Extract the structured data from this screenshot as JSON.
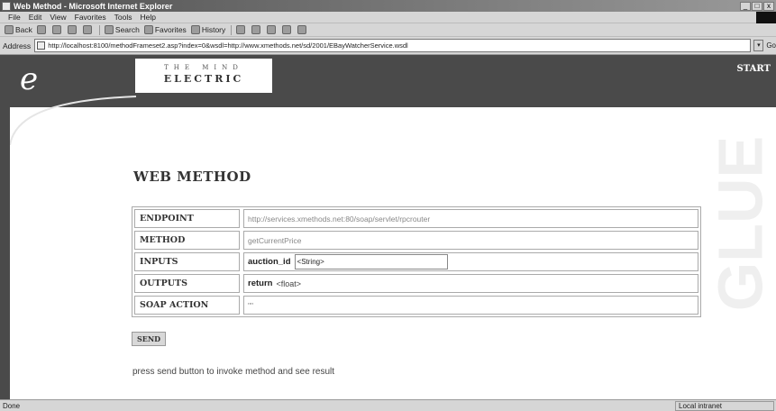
{
  "window": {
    "title": "Web Method - Microsoft Internet Explorer",
    "controls": [
      "_",
      "□",
      "x"
    ]
  },
  "menu": [
    "File",
    "Edit",
    "View",
    "Favorites",
    "Tools",
    "Help"
  ],
  "toolbar": {
    "back": "Back",
    "search": "Search",
    "favorites": "Favorites",
    "history": "History"
  },
  "address": {
    "label": "Address",
    "url": "http://localhost:8100/methodFrameset2.asp?index=0&wsdl=http://www.xmethods.net/sd/2001/EBayWatcherService.wsdl",
    "go": "Go"
  },
  "header": {
    "logo_top": "THE MIND",
    "logo_bottom": "ELECTRIC",
    "start_link": "START",
    "watermark": "GLUE"
  },
  "page": {
    "title": "WEB METHOD",
    "rows": [
      {
        "label": "ENDPOINT",
        "value": "http://services.xmethods.net:80/soap/servlet/rpcrouter"
      },
      {
        "label": "METHOD",
        "value": "getCurrentPrice"
      },
      {
        "label": "INPUTS",
        "param": "auction_id",
        "input_value": "<String>"
      },
      {
        "label": "OUTPUTS",
        "param": "return",
        "type": "<float>"
      },
      {
        "label": "SOAP ACTION",
        "value": "\"\""
      }
    ],
    "send_label": "SEND",
    "hint": "press send button to invoke method and see result"
  },
  "status": {
    "text": "Done",
    "zone": "Local intranet"
  }
}
